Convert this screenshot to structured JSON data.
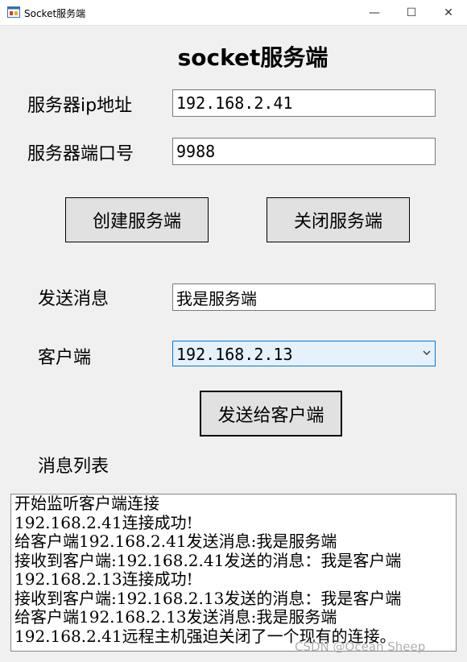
{
  "window": {
    "title": "Socket服务端",
    "minimize": "—",
    "maximize": "☐",
    "close": "✕"
  },
  "heading": "socket服务端",
  "server_ip": {
    "label": "服务器ip地址",
    "value": "192.168.2.41"
  },
  "server_port": {
    "label": "服务器端口号",
    "value": "9988"
  },
  "buttons": {
    "create_server": "创建服务端",
    "close_server": "关闭服务端",
    "send_to_client": "发送给客户端"
  },
  "send_message": {
    "label": "发送消息",
    "value": "我是服务端"
  },
  "client": {
    "label": "客户端",
    "selected": "192.168.2.13"
  },
  "message_list": {
    "label": "消息列表",
    "items": [
      "开始监听客户端连接",
      "192.168.2.41连接成功!",
      "给客户端192.168.2.41发送消息:我是服务端",
      "接收到客户端:192.168.2.41发送的消息：我是客户端",
      "192.168.2.13连接成功!",
      "接收到客户端:192.168.2.13发送的消息：我是客户端",
      "给客户端192.168.2.13发送消息:我是服务端",
      "192.168.2.41远程主机强迫关闭了一个现有的连接。"
    ]
  },
  "watermark": "CSDN @Ocean Sheep"
}
